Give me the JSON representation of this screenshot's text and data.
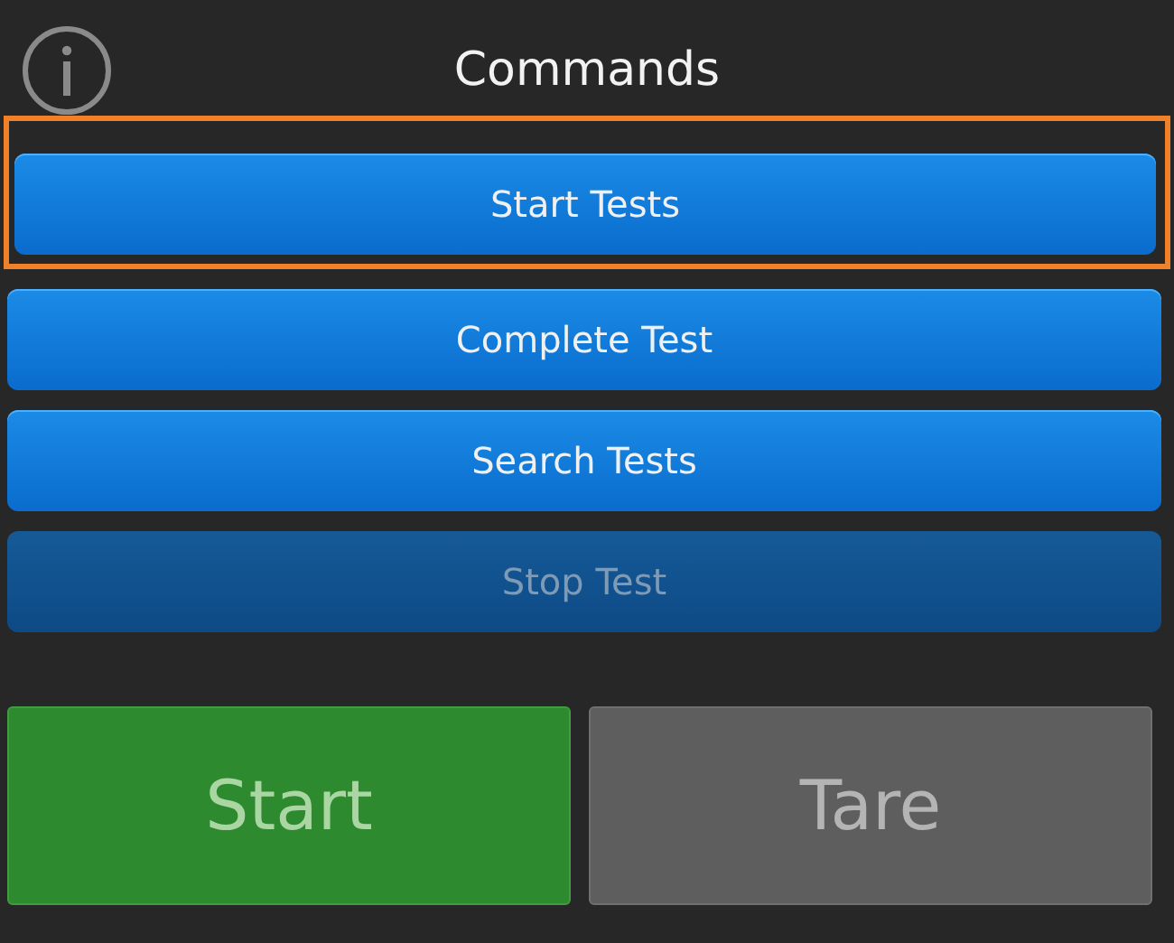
{
  "header": {
    "title": "Commands"
  },
  "commands": [
    {
      "label": "Start Tests",
      "highlighted": true,
      "disabled": false
    },
    {
      "label": "Complete Test",
      "highlighted": false,
      "disabled": false
    },
    {
      "label": "Search Tests",
      "highlighted": false,
      "disabled": false
    },
    {
      "label": "Stop Test",
      "highlighted": false,
      "disabled": true
    }
  ],
  "actions": [
    {
      "label": "Start",
      "kind": "go"
    },
    {
      "label": "Tare",
      "kind": "neutral"
    }
  ]
}
